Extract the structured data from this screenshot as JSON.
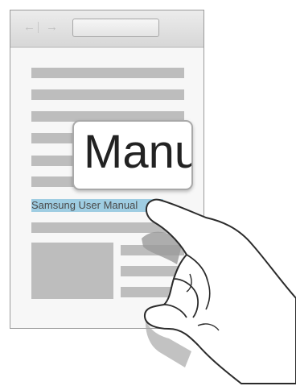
{
  "browser": {
    "back_icon": "←",
    "forward_icon": "→",
    "url_value": ""
  },
  "page": {
    "selected_text": "Samsung User Manual",
    "magnifier_text": "Manu"
  },
  "colors": {
    "selection_highlight": "#9fcde2",
    "placeholder_line": "#bdbdbd"
  }
}
